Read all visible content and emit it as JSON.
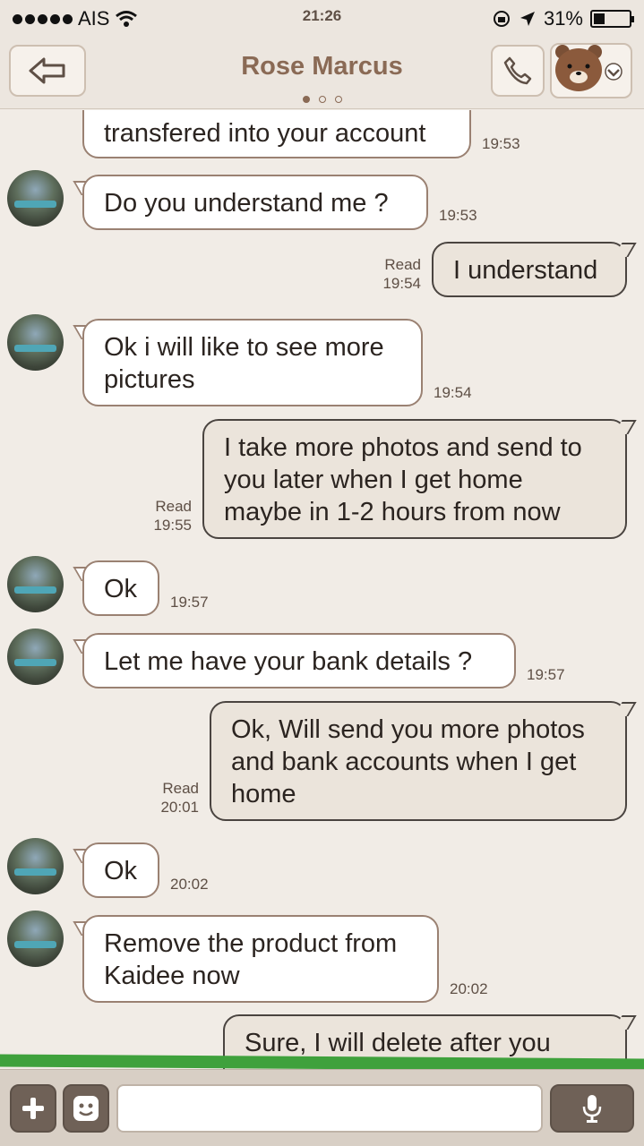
{
  "status_bar": {
    "carrier": "AIS",
    "time": "21:26",
    "battery": "31%"
  },
  "header": {
    "title": "Rose Marcus"
  },
  "messages": [
    {
      "dir": "in",
      "text": "transfered into your account",
      "time": "19:53"
    },
    {
      "dir": "in",
      "text": "Do you understand me ?",
      "time": "19:53"
    },
    {
      "dir": "out",
      "text": "I understand",
      "read": "Read",
      "time": "19:54"
    },
    {
      "dir": "in",
      "text": "Ok i will like to see more pictures",
      "line1": "Ok i will like to see more",
      "line2": "pictures",
      "time": "19:54"
    },
    {
      "dir": "out",
      "text": "I take more photos and send to you later when I get home maybe in 1-2 hours from now",
      "line1": "I take more photos and send to",
      "line2": "you later when I get home",
      "line3": "maybe in 1-2 hours from now",
      "read": "Read",
      "time": "19:55"
    },
    {
      "dir": "in",
      "text": "Ok",
      "time": "19:57"
    },
    {
      "dir": "in",
      "text": "Let me have your bank details ?",
      "time": "19:57"
    },
    {
      "dir": "out",
      "text": "Ok, Will send you more photos and bank accounts when I get home",
      "line1": "Ok, Will send you more photos",
      "line2": "and bank accounts when I get",
      "line3": "home",
      "read": "Read",
      "time": "20:01"
    },
    {
      "dir": "in",
      "text": "Ok",
      "time": "20:02"
    },
    {
      "dir": "in",
      "text": "Remove the product from Kaidee now",
      "line1": "Remove the product from",
      "line2": "Kaidee now",
      "time": "20:02"
    },
    {
      "dir": "out",
      "text": "Sure, I will delete after you",
      "line1": "Sure, I will delete after you"
    }
  ],
  "input": {
    "placeholder": "",
    "value": ""
  },
  "icons": {
    "back": "back-arrow-icon",
    "call": "phone-icon",
    "sticker": "bear-sticker-icon",
    "plus": "plus-icon",
    "emoji": "emoji-icon",
    "mic": "microphone-icon"
  }
}
